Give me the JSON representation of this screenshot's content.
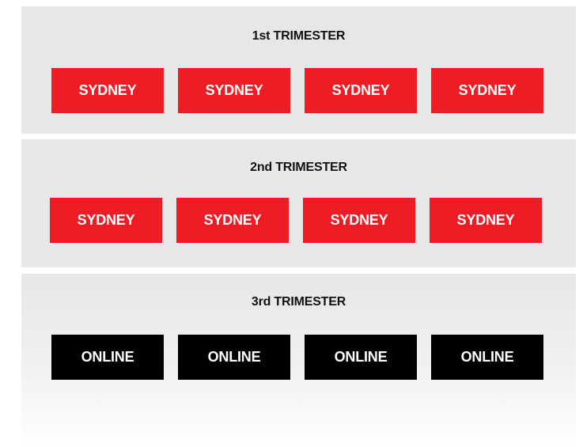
{
  "colors": {
    "panel_background": "#e6e7e8",
    "campus_chip": "#ee1c25",
    "online_chip": "#000000",
    "chip_text": "#ffffff"
  },
  "trimesters": [
    {
      "title": "1st TRIMESTER",
      "chips": [
        "SYDNEY",
        "SYDNEY",
        "SYDNEY",
        "SYDNEY"
      ]
    },
    {
      "title": "2nd TRIMESTER",
      "chips": [
        "SYDNEY",
        "SYDNEY",
        "SYDNEY",
        "SYDNEY"
      ]
    },
    {
      "title": "3rd TRIMESTER",
      "chips": [
        "ONLINE",
        "ONLINE",
        "ONLINE",
        "ONLINE"
      ]
    }
  ]
}
